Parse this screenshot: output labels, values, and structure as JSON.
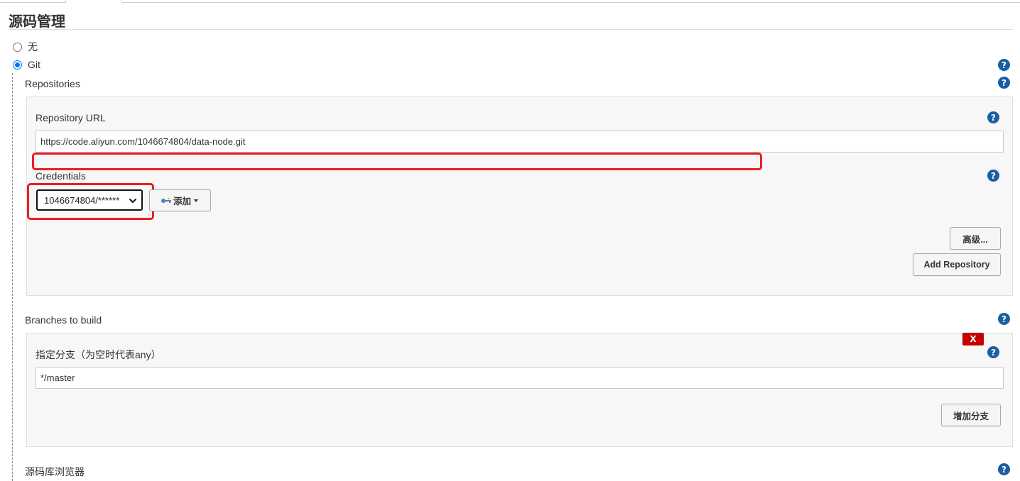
{
  "section": {
    "title": "源码管理"
  },
  "scm_options": [
    {
      "label": "无",
      "checked": false
    },
    {
      "label": "Git",
      "checked": true
    }
  ],
  "repositories": {
    "label": "Repositories",
    "repository_url": {
      "label": "Repository URL",
      "value": "https://code.aliyun.com/1046674804/data-node.git"
    },
    "credentials": {
      "label": "Credentials",
      "selected": "1046674804/******",
      "add_label": "添加"
    },
    "advanced_label": "高级...",
    "add_repository_label": "Add Repository"
  },
  "branches": {
    "label": "Branches to build",
    "branch_spec_label": "指定分支（为空时代表any）",
    "branch_spec_value": "*/master",
    "delete_label": "X",
    "add_branch_label": "增加分支"
  },
  "repo_browser": {
    "label": "源码库浏览器"
  },
  "help_glyph": "?",
  "colors": {
    "help_icon": "#1a5fa3",
    "annotation_red": "#ee1c25",
    "delete_red": "#c40000",
    "radio_blue": "#0075ff"
  }
}
